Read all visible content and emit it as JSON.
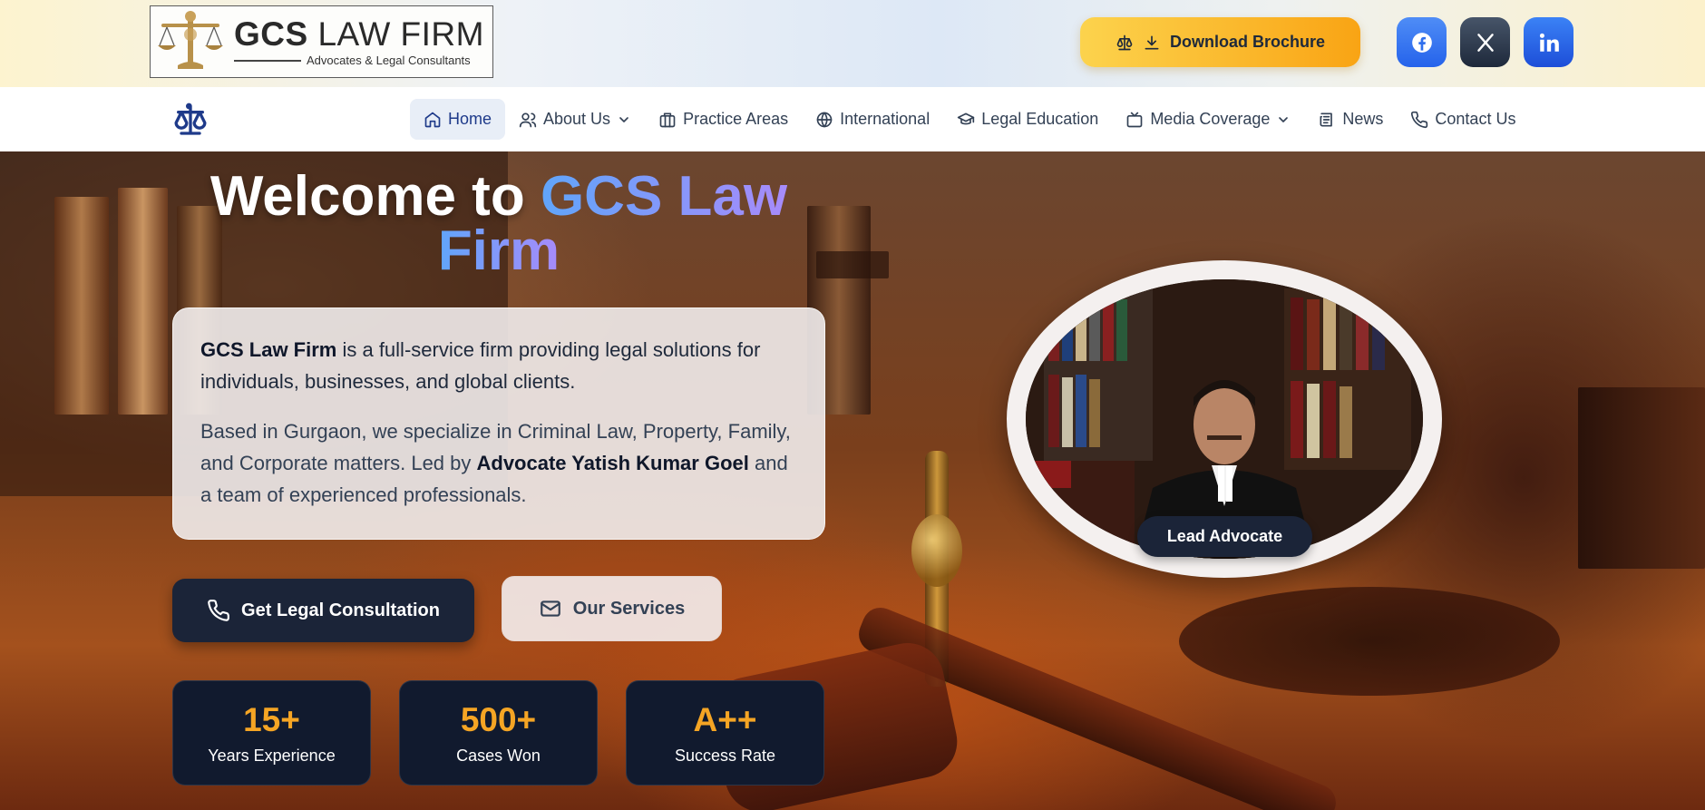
{
  "header": {
    "logo": {
      "brand_bold": "GCS",
      "brand_rest": "LAW FIRM",
      "tagline": "Advocates & Legal Consultants"
    },
    "brochure_button": {
      "label": "Download Brochure",
      "icons": [
        "scale-icon",
        "download-icon"
      ]
    },
    "social": [
      {
        "name": "facebook",
        "icon": "facebook-icon",
        "color": "#2563eb"
      },
      {
        "name": "x",
        "icon": "x-icon",
        "color": "#1e293b"
      },
      {
        "name": "linkedin",
        "icon": "linkedin-icon",
        "color": "#1d4ed8"
      }
    ]
  },
  "nav": {
    "items": [
      {
        "label": "Home",
        "icon": "home-icon",
        "active": true,
        "dropdown": false
      },
      {
        "label": "About Us",
        "icon": "user-icon",
        "active": false,
        "dropdown": true
      },
      {
        "label": "Practice Areas",
        "icon": "briefcase-icon",
        "active": false,
        "dropdown": false
      },
      {
        "label": "International",
        "icon": "globe-icon",
        "active": false,
        "dropdown": false
      },
      {
        "label": "Legal Education",
        "icon": "graduation-cap-icon",
        "active": false,
        "dropdown": false
      },
      {
        "label": "Media Coverage",
        "icon": "tv-icon",
        "active": false,
        "dropdown": true
      },
      {
        "label": "News",
        "icon": "newspaper-icon",
        "active": false,
        "dropdown": false
      },
      {
        "label": "Contact Us",
        "icon": "phone-icon",
        "active": false,
        "dropdown": false
      }
    ]
  },
  "hero": {
    "title_prefix": "Welcome to",
    "title_highlight_1": "GCS Law",
    "title_highlight_2": "Firm",
    "intro": {
      "p1_bold": "GCS Law Firm",
      "p1_rest": " is a full-service firm providing legal solutions for individuals, businesses, and global clients.",
      "p2_start": "Based in Gurgaon, we specialize in Criminal Law, Property, Family, and Corporate matters. Led by ",
      "p2_bold": "Advocate Yatish Kumar Goel",
      "p2_end": " and a team of experienced professionals."
    },
    "cta_primary": {
      "label": "Get Legal Consultation",
      "icon": "phone-icon"
    },
    "cta_secondary": {
      "label": "Our Services",
      "icon": "mail-icon"
    },
    "stats": [
      {
        "value": "15+",
        "label": "Years Experience"
      },
      {
        "value": "500+",
        "label": "Cases Won"
      },
      {
        "value": "A++",
        "label": "Success Rate"
      }
    ],
    "portrait_badge": "Lead Advocate"
  },
  "colors": {
    "accent_gold": "#f5a524",
    "navy": "#1b2438",
    "title_gradient": [
      "#60a5fa",
      "#a78bfa"
    ],
    "brochure_gradient": [
      "#fcd34d",
      "#f9a414"
    ]
  }
}
